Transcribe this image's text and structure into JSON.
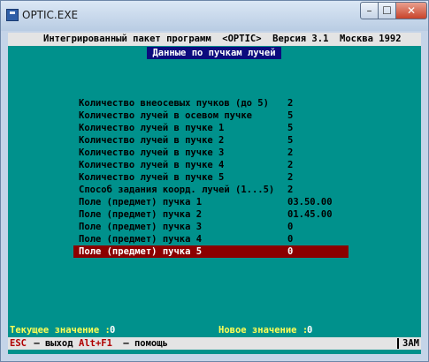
{
  "window": {
    "title": "OPTIC.EXE",
    "min": "–",
    "max": "☐",
    "close": "✕"
  },
  "header": "Интегрированный пакет программ  <OPTIC>  Версия 3.1  Москва 1992",
  "dialog_title": "Данные по пучкам лучей",
  "rows": [
    {
      "label": "Количество внеосевых пучков (до 5)",
      "value": "2"
    },
    {
      "label": "Количество лучей в осевом пучке",
      "value": "5"
    },
    {
      "label": "Количество лучей в пучке 1",
      "value": "5"
    },
    {
      "label": "Количество лучей в пучке 2",
      "value": "5"
    },
    {
      "label": "Количество лучей в пучке 3",
      "value": "2"
    },
    {
      "label": "Количество лучей в пучке 4",
      "value": "2"
    },
    {
      "label": "Количество лучей в пучке 5",
      "value": "2"
    },
    {
      "label": "Способ задания коорд. лучей (1...5)",
      "value": "2"
    },
    {
      "label": "Поле (предмет) пучка 1",
      "value": "03.50.00"
    },
    {
      "label": "Поле (предмет) пучка 2",
      "value": "01.45.00"
    },
    {
      "label": "Поле (предмет) пучка 3",
      "value": "0"
    },
    {
      "label": "Поле (предмет) пучка 4",
      "value": "0"
    },
    {
      "label": "Поле (предмет) пучка 5",
      "value": "0"
    }
  ],
  "selected_index": 12,
  "status": {
    "current_label": "Текущее значение :",
    "current_value": "0",
    "new_label": "Новое значение :",
    "new_value": "0"
  },
  "footer": {
    "esc_key": "ESC",
    "esc_text": " – выход",
    "help_key": "Alt+F1",
    "help_text": " – помощь",
    "mode": "ЗАМ"
  },
  "colors": {
    "screen": "#00918c",
    "selection": "#8b0000",
    "title_bg": "#0b0b7d",
    "status_text": "#ffff55"
  }
}
